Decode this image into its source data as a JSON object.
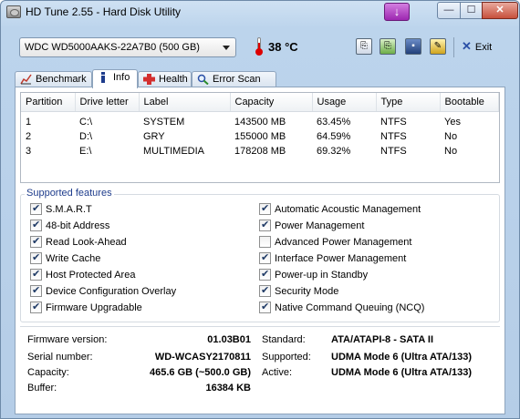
{
  "window": {
    "title": "HD Tune 2.55 - Hard Disk Utility",
    "screenshot_glyph": "↓",
    "minimize_glyph": "—",
    "maximize_glyph": "☐",
    "close_glyph": "✕"
  },
  "toolbar": {
    "drive": "WDC WD5000AAKS-22A7B0 (500 GB)",
    "temperature": "38 °C",
    "exit_label": "Exit",
    "icons": [
      "copy-icon",
      "copy-all-icon",
      "save-icon",
      "options-icon"
    ]
  },
  "tabs": [
    {
      "label": "Benchmark",
      "active": false
    },
    {
      "label": "Info",
      "active": true
    },
    {
      "label": "Health",
      "active": false
    },
    {
      "label": "Error Scan",
      "active": false
    }
  ],
  "partitions": {
    "columns": [
      "Partition",
      "Drive letter",
      "Label",
      "Capacity",
      "Usage",
      "Type",
      "Bootable"
    ],
    "rows": [
      [
        "1",
        "C:\\",
        "SYSTEM",
        "143500 MB",
        "63.45%",
        "NTFS",
        "Yes"
      ],
      [
        "2",
        "D:\\",
        "GRY",
        "155000 MB",
        "64.59%",
        "NTFS",
        "No"
      ],
      [
        "3",
        "E:\\",
        "MULTIMEDIA",
        "178208 MB",
        "69.32%",
        "NTFS",
        "No"
      ]
    ]
  },
  "features": {
    "title": "Supported features",
    "left": [
      {
        "label": "S.M.A.R.T",
        "checked": true
      },
      {
        "label": "48-bit Address",
        "checked": true
      },
      {
        "label": "Read Look-Ahead",
        "checked": true
      },
      {
        "label": "Write Cache",
        "checked": true
      },
      {
        "label": "Host Protected Area",
        "checked": true
      },
      {
        "label": "Device Configuration Overlay",
        "checked": true
      },
      {
        "label": "Firmware Upgradable",
        "checked": true
      }
    ],
    "right": [
      {
        "label": "Automatic Acoustic Management",
        "checked": true
      },
      {
        "label": "Power Management",
        "checked": true
      },
      {
        "label": "Advanced Power Management",
        "checked": false
      },
      {
        "label": "Interface Power Management",
        "checked": true
      },
      {
        "label": "Power-up in Standby",
        "checked": true
      },
      {
        "label": "Security Mode",
        "checked": true
      },
      {
        "label": "Native Command Queuing (NCQ)",
        "checked": true
      }
    ]
  },
  "info": {
    "firmware_label": "Firmware version:",
    "firmware": "01.03B01",
    "serial_label": "Serial number:",
    "serial": "WD-WCASY2170811",
    "capacity_label": "Capacity:",
    "capacity": "465.6 GB (~500.0 GB)",
    "buffer_label": "Buffer:",
    "buffer": "16384 KB",
    "standard_label": "Standard:",
    "standard": "ATA/ATAPI-8 - SATA II",
    "supported_label": "Supported:",
    "supported": "UDMA Mode 6 (Ultra ATA/133)",
    "active_label": "Active:",
    "active": "UDMA Mode 6 (Ultra ATA/133)"
  }
}
